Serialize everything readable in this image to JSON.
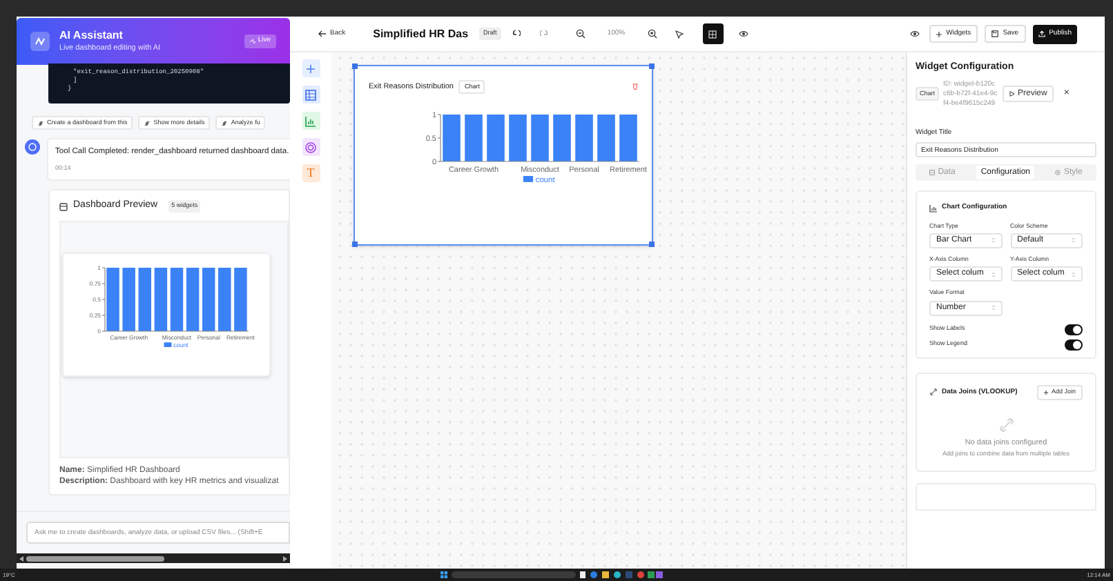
{
  "assistant": {
    "title": "AI Assistant",
    "subtitle": "Live dashboard editing with AI",
    "badge": "Live",
    "code_lines": [
      "\"exit_reason_distribution_20250908\"",
      "]",
      "}"
    ],
    "suggestions": [
      "Create a dashboard from this",
      "Show more details",
      "Analyze fu"
    ],
    "message": {
      "text": "Tool Call Completed: render_dashboard returned dashboard data.",
      "time": "00:14"
    },
    "preview": {
      "title": "Dashboard Preview",
      "badge": "5 widgets",
      "chart_data": {
        "type": "bar",
        "categories": [
          null,
          "Career Growth",
          null,
          null,
          "Misconduct",
          null,
          "Personal",
          null,
          "Retirement"
        ],
        "series": [
          {
            "name": "count",
            "color": "#3b82f6",
            "values": [
              1,
              1,
              1,
              1,
              1,
              1,
              1,
              1,
              1
            ]
          }
        ],
        "ylim": [
          0,
          1
        ],
        "yticks": [
          0,
          0.25,
          0.5,
          0.75,
          1
        ]
      },
      "name": "**Name:** Simplified HR Dashboard",
      "description": "**Description:** Dashboard with key HR metrics and visualizat"
    },
    "input": {
      "placeholder": "Ask me to create dashboards, analyze data, or upload CSV files... (Shift+E"
    }
  },
  "toolbar": {
    "back": "Back",
    "title": "Simplified HR Das",
    "status": "Draft",
    "zoom": "100%",
    "grid_on": true,
    "widgets": "Widgets",
    "save": "Save",
    "publish": "Publish"
  },
  "tools": [
    {
      "kind": "add"
    },
    {
      "kind": "table"
    },
    {
      "kind": "chart"
    },
    {
      "kind": "target"
    },
    {
      "kind": "text",
      "label": "T"
    }
  ],
  "widget": {
    "title": "Exit Reasons Distribution",
    "badge": "Chart",
    "selected": true,
    "chart_data": {
      "type": "bar",
      "categories": [
        null,
        "Career Growth",
        null,
        null,
        "Misconduct",
        null,
        "Personal",
        null,
        "Retirement"
      ],
      "series": [
        {
          "name": "count",
          "color": "#3b82f6",
          "values": [
            1,
            1,
            1,
            1,
            1,
            1,
            1,
            1,
            1
          ]
        }
      ],
      "ylim": [
        0,
        1
      ],
      "yticks": [
        0,
        0.5,
        1
      ]
    }
  },
  "config": {
    "title": "Widget Configuration",
    "badge": "Chart",
    "id": "ID: widget-b120cc6b-b72f-41e4-9cf4-be4f9615c249",
    "preview": "Preview",
    "close": "×",
    "title_label": "Widget Title",
    "title_value": "Exit Reasons Distribution",
    "tabs": [
      {
        "label": "Data",
        "selected": false
      },
      {
        "label": "Configuration",
        "selected": true
      },
      {
        "label": "Style",
        "selected": false
      }
    ],
    "chart_config": {
      "heading": "Chart Configuration",
      "fields": [
        {
          "label": "Chart Type",
          "value": "Bar Chart"
        },
        {
          "label": "Color Scheme",
          "value": "Default"
        },
        {
          "label": "X-Axis Column",
          "value": "Select colum"
        },
        {
          "label": "Y-Axis Column",
          "value": "Select colum"
        },
        {
          "label": "Value Format",
          "value": "Number"
        }
      ],
      "toggles": [
        {
          "label": "Show Labels",
          "on": true
        },
        {
          "label": "Show Legend",
          "on": true
        }
      ]
    },
    "joins": {
      "heading": "Data Joins (VLOOKUP)",
      "add": "Add Join",
      "empty": "No data joins configured",
      "hint": "Add joins to combine data from multiple tables"
    }
  },
  "taskbar": {
    "weather": "19°C",
    "clock": "12:14 AM"
  }
}
